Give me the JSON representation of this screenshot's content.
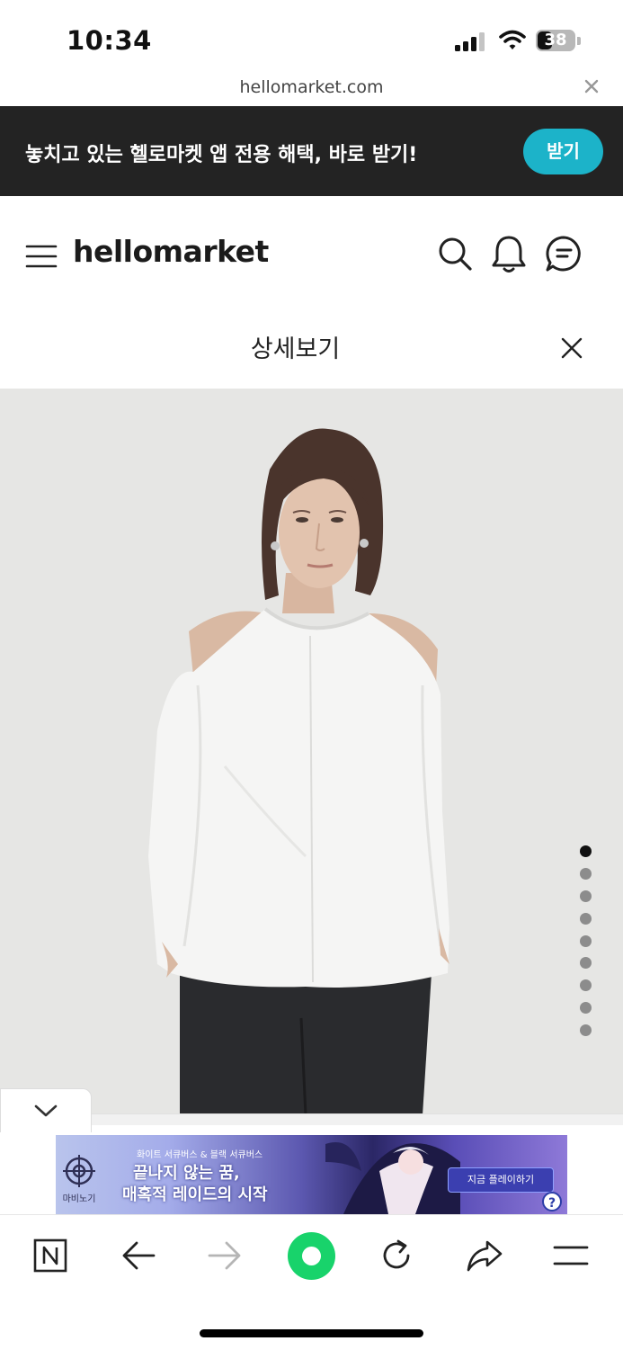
{
  "status_bar": {
    "time": "10:34",
    "battery": "38"
  },
  "browser": {
    "url": "hellomarket.com"
  },
  "app_banner": {
    "text": "놓치고 있는 헬로마켓 앱 전용 해택, 바로 받기!",
    "button": "받기"
  },
  "header": {
    "logo": "hellomarket"
  },
  "detail": {
    "title": "상세보기"
  },
  "image_viewer": {
    "total_images": 9,
    "current_index": 1
  },
  "ad": {
    "logo_text": "마비노기",
    "subtitle": "화이트 서큐버스 & 블랙 서큐버스",
    "title_line1": "끝나지 않는 꿈,",
    "title_line2": "매혹적 레이드의 시작",
    "cta": "지금 플레이하기",
    "help": "?"
  },
  "colors": {
    "banner_bg": "#232323",
    "accent_cyan": "#1cb3c9",
    "naver_green": "#18d36b"
  }
}
